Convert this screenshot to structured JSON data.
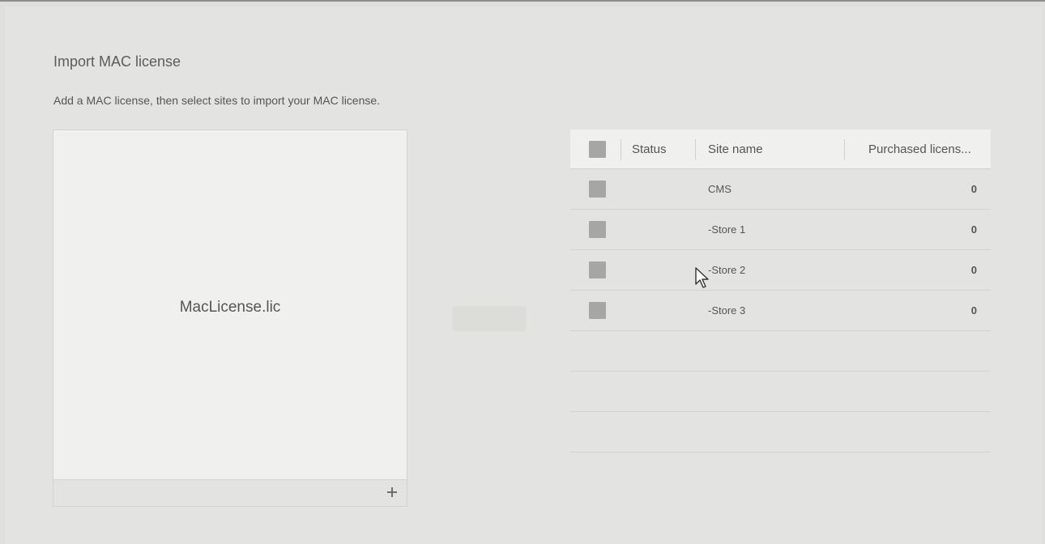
{
  "dialog": {
    "title": "Import MAC license",
    "subtitle": "Add a MAC license, then select sites to import your MAC license."
  },
  "license_panel": {
    "file_name": "MacLicense.lic",
    "add_icon": "plus-icon"
  },
  "sites_table": {
    "columns": {
      "status": "Status",
      "site_name": "Site name",
      "purchased_licenses": "Purchased licens..."
    },
    "rows": [
      {
        "site_name": "CMS",
        "purchased_licenses": "0"
      },
      {
        "site_name": "-Store 1",
        "purchased_licenses": "0"
      },
      {
        "site_name": "-Store 2",
        "purchased_licenses": "0"
      },
      {
        "site_name": "-Store 3",
        "purchased_licenses": "0"
      }
    ]
  },
  "colors": {
    "background": "#dfe0dd",
    "panel": "#f0f0ee",
    "checkbox": "#a6a7a5",
    "text": "#555555"
  }
}
